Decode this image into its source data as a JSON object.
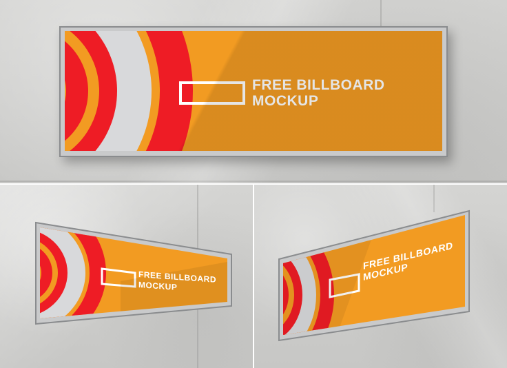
{
  "billboard": {
    "line1": "FREE BILLBOARD",
    "line2": "MOCKUP"
  },
  "colors": {
    "wall": "#cbcbc9",
    "board": "#f29b22",
    "stripe_red": "#ee1c25",
    "stripe_white": "#d8d9db",
    "frame": "#c9cacb"
  },
  "mockups": [
    {
      "view": "front"
    },
    {
      "view": "angled-left"
    },
    {
      "view": "angled-right"
    }
  ]
}
